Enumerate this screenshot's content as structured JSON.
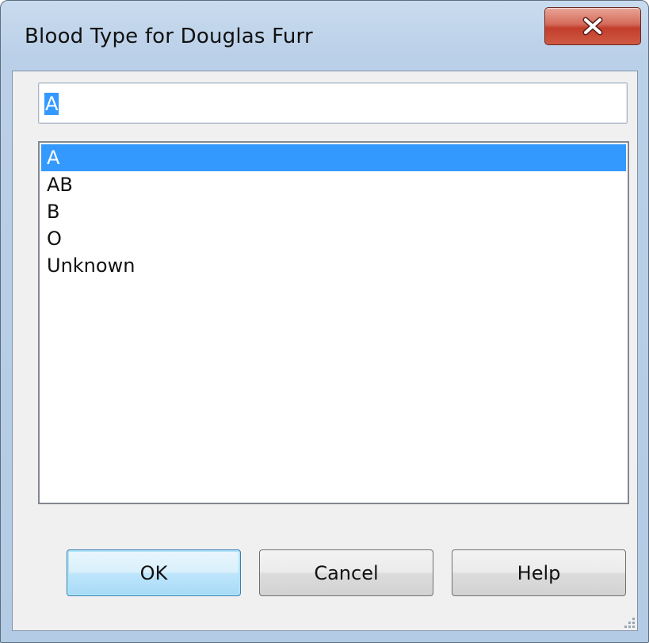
{
  "window": {
    "title": "Blood Type for Douglas Furr",
    "close_label": "x"
  },
  "input": {
    "value": "A"
  },
  "list": {
    "items": [
      {
        "label": "A",
        "selected": true
      },
      {
        "label": "AB",
        "selected": false
      },
      {
        "label": "B",
        "selected": false
      },
      {
        "label": "O",
        "selected": false
      },
      {
        "label": "Unknown",
        "selected": false
      }
    ]
  },
  "buttons": {
    "ok": "OK",
    "cancel": "Cancel",
    "help": "Help"
  },
  "colors": {
    "selection": "#3399ff",
    "close_button": "#c94a35",
    "frame": "#bad0e8"
  }
}
